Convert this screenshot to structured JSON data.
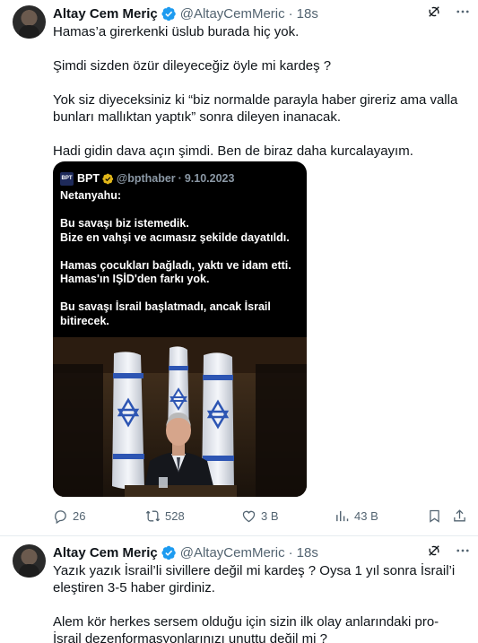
{
  "tweets": [
    {
      "author": "Altay Cem Meriç",
      "handle": "@AltayCemMeric",
      "separator": "·",
      "time": "18s",
      "paragraphs": [
        "Hamas’a girerkenki üslub burada hiç yok.",
        "Şimdi sizden özür dileyeceğiz öyle mi kardeş ?",
        "Yok siz diyeceksiniz ki “biz normalde parayla haber gireriz ama valla bunları mallıktan yaptık” sonra dileyen inanacak.",
        "Hadi gidin dava açın şimdi. Ben de biraz daha kurcalayayım."
      ],
      "embed": {
        "logo_text": "BPT",
        "name": "BPT",
        "handle": "@bpthaber",
        "separator": "·",
        "date": "9.10.2023",
        "paragraphs": [
          "Netanyahu:",
          "Bu savaşı biz istemedik.\nBize en vahşi ve acımasız şekilde dayatıldı.",
          "Hamas çocukları bağladı, yaktı ve idam etti.\nHamas'ın IŞİD'den farkı yok.",
          "Bu savaşı İsrail başlatmadı, ancak İsrail\nbitirecek."
        ]
      },
      "actions": {
        "replies": "26",
        "reposts": "528",
        "likes": "3 B",
        "views": "43 B"
      }
    },
    {
      "author": "Altay Cem Meriç",
      "handle": "@AltayCemMeric",
      "separator": "·",
      "time": "18s",
      "paragraphs": [
        "Yazık yazık İsrail’li sivillere değil mi kardeş ? Oysa 1 yıl sonra İsrail’i eleştiren 3-5 haber girdiniz.",
        "Alem kör herkes sersem olduğu için sizin ilk olay anlarındaki pro-İsrail dezenformasyonlarınızı unuttu değil mi ?"
      ]
    }
  ],
  "colors": {
    "verified": "#1d9bf0",
    "embed_verified": "#e2b719",
    "muted": "#536471",
    "text": "#0f1419"
  },
  "icons": [
    "verified-badge-icon",
    "grok-icon",
    "more-icon",
    "reply-icon",
    "repost-icon",
    "like-icon",
    "views-icon",
    "bookmark-icon",
    "share-icon"
  ]
}
